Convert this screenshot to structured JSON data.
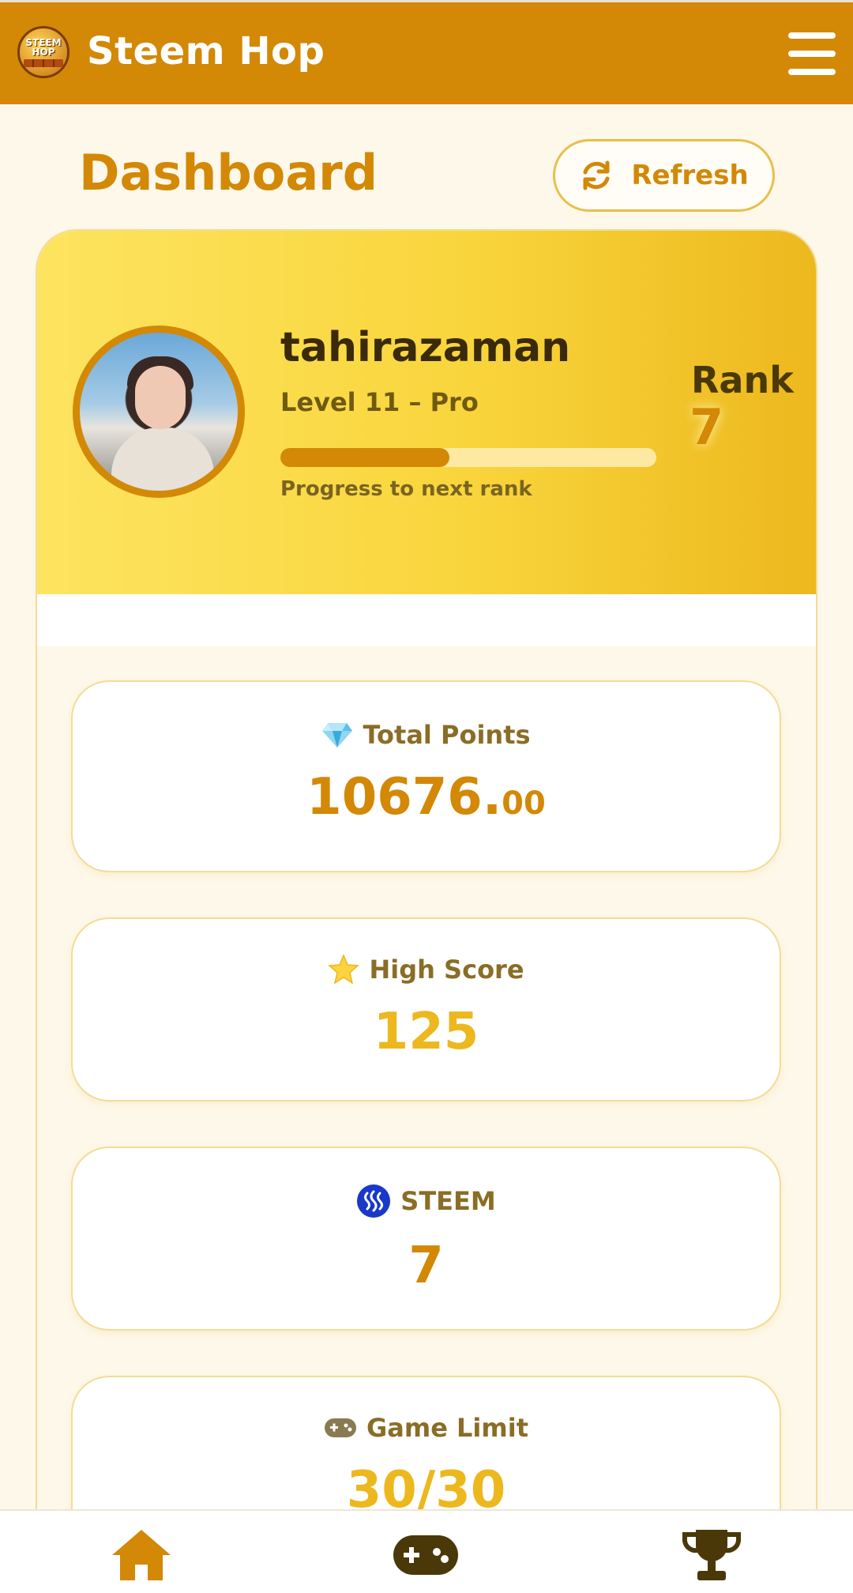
{
  "header": {
    "app_title": "Steem Hop",
    "logo_text": "STEEM HOP"
  },
  "page": {
    "title": "Dashboard",
    "refresh_label": "Refresh"
  },
  "profile": {
    "username": "tahirazaman",
    "level": "Level 11 – Pro",
    "progress_fraction": 0.45,
    "progress_label": "Progress to next rank",
    "rank_label": "Rank",
    "rank_value": "7"
  },
  "stats": {
    "total_points": {
      "label": "Total Points",
      "value_int": "10676.",
      "value_dec": "00",
      "icon": "gem-icon"
    },
    "high_score": {
      "label": "High Score",
      "value": "125",
      "icon": "star-icon"
    },
    "steem": {
      "label": "STEEM",
      "value": "7",
      "icon": "steem-icon"
    },
    "game_limit": {
      "label": "Game Limit",
      "value": "30/30",
      "icon": "gamepad-icon"
    }
  },
  "colors": {
    "brand": "#d38806",
    "accent_gold": "#ecb81e",
    "steem_blue": "#1a38c9",
    "dark": "#3a2a08"
  }
}
